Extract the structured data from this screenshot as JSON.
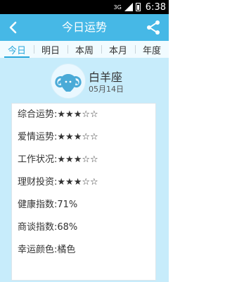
{
  "status_bar": {
    "network": "3G",
    "time": "6:38"
  },
  "app_bar": {
    "title": "今日运势",
    "back_icon": "back-chevron-icon",
    "share_icon": "share-icon"
  },
  "tabs": [
    {
      "label": "今日",
      "active": true
    },
    {
      "label": "明日",
      "active": false
    },
    {
      "label": "本周",
      "active": false
    },
    {
      "label": "本月",
      "active": false
    },
    {
      "label": "年度",
      "active": false
    }
  ],
  "sign": {
    "name": "白羊座",
    "date": "05月14日",
    "icon": "aries-ram-icon"
  },
  "fortune": [
    {
      "label": "综合运势:",
      "value": "★★★☆☆"
    },
    {
      "label": "爱情运势:",
      "value": "★★★☆☆"
    },
    {
      "label": "工作状况:",
      "value": "★★★☆☆"
    },
    {
      "label": "理财投资:",
      "value": "★★★☆☆"
    },
    {
      "label": "健康指数:",
      "value": "71%"
    },
    {
      "label": "商谈指数:",
      "value": "68%"
    },
    {
      "label": "幸运颜色:",
      "value": "橘色"
    }
  ],
  "colors": {
    "status_bar": "#000000",
    "app_bar": "#46b8e6",
    "tab_active": "#2aa7db",
    "content_bg": "#c7ecfb"
  }
}
